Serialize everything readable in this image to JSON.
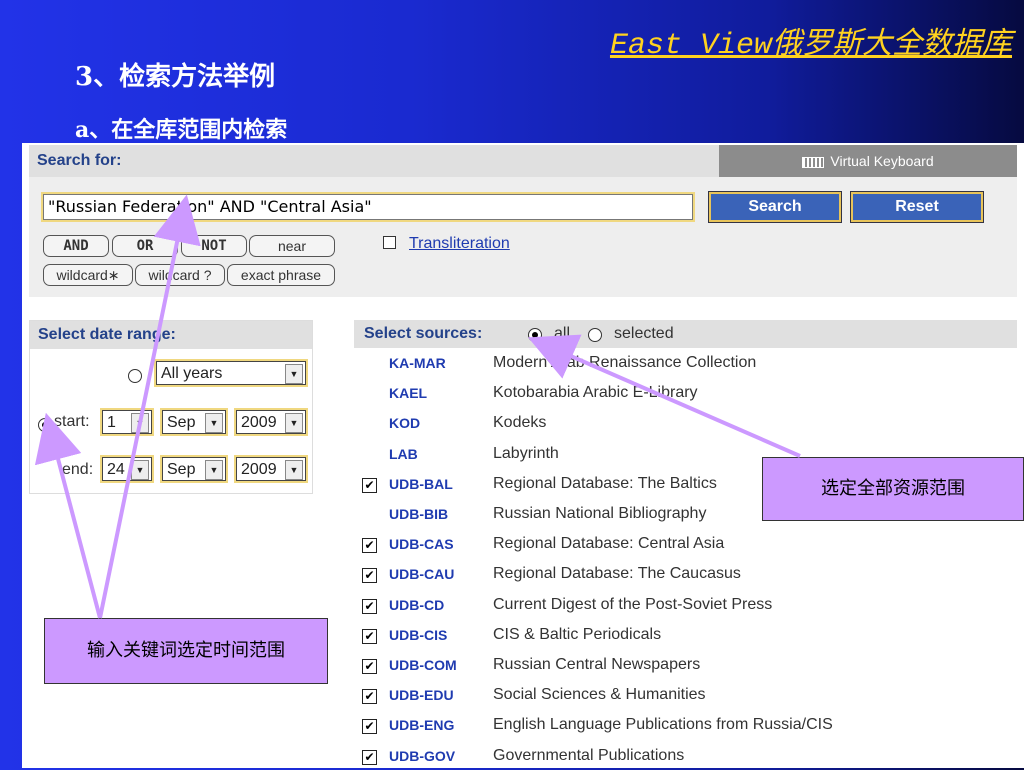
{
  "slide": {
    "brand": "East View俄罗斯大全数据库",
    "heading": "3、检索方法举例",
    "subheading": "a、在全库范围内检索"
  },
  "search": {
    "label": "Search for:",
    "virtual_keyboard": "Virtual Keyboard",
    "query": "\"Russian Federation\" AND \"Central Asia\"",
    "search_button": "Search",
    "reset_button": "Reset",
    "operators": [
      "AND",
      "OR",
      "NOT",
      "near"
    ],
    "wildcards": [
      "wildcard∗",
      "wildcard ?",
      "exact phrase"
    ],
    "transliteration": "Transliteration"
  },
  "date_range": {
    "label": "Select date range:",
    "all_years": "All years",
    "start_label": "start:",
    "end_label": "end:",
    "start": {
      "day": "1",
      "month": "Sep",
      "year": "2009"
    },
    "end": {
      "day": "24",
      "month": "Sep",
      "year": "2009"
    }
  },
  "sources": {
    "label": "Select sources:",
    "opt_all": "all",
    "opt_selected": "selected",
    "items": [
      {
        "code": "KA-MAR",
        "name": "Modern Arab Renaissance Collection",
        "checked": false
      },
      {
        "code": "KAEL",
        "name": "Kotobarabia Arabic E-Library",
        "checked": false
      },
      {
        "code": "KOD",
        "name": "Kodeks",
        "checked": false
      },
      {
        "code": "LAB",
        "name": "Labyrinth",
        "checked": false
      },
      {
        "code": "UDB-BAL",
        "name": "Regional Database: The Baltics",
        "checked": true
      },
      {
        "code": "UDB-BIB",
        "name": "Russian National Bibliography",
        "checked": false
      },
      {
        "code": "UDB-CAS",
        "name": "Regional Database: Central Asia",
        "checked": true
      },
      {
        "code": "UDB-CAU",
        "name": "Regional Database: The Caucasus",
        "checked": true
      },
      {
        "code": "UDB-CD",
        "name": "Current Digest of the Post-Soviet Press",
        "checked": true
      },
      {
        "code": "UDB-CIS",
        "name": "CIS & Baltic Periodicals",
        "checked": true
      },
      {
        "code": "UDB-COM",
        "name": "Russian Central Newspapers",
        "checked": true
      },
      {
        "code": "UDB-EDU",
        "name": "Social Sciences & Humanities",
        "checked": true
      },
      {
        "code": "UDB-ENG",
        "name": "English Language Publications from Russia/CIS",
        "checked": true
      },
      {
        "code": "UDB-GOV",
        "name": "Governmental Publications",
        "checked": true
      }
    ]
  },
  "callouts": {
    "sources_note": "选定全部资源范围",
    "keyword_note": "输入关键词选定时间范围"
  },
  "colors": {
    "accent": "#cc99ff",
    "brand": "#ffd21f",
    "arrow": "#cc99ff"
  }
}
